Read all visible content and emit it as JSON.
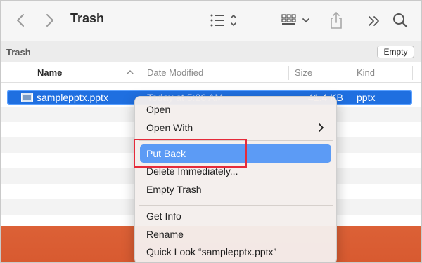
{
  "toolbar": {
    "title": "Trash"
  },
  "pathbar": {
    "label": "Trash",
    "empty_button": "Empty"
  },
  "columns": {
    "name": "Name",
    "date_modified": "Date Modified",
    "size": "Size",
    "kind": "Kind"
  },
  "file": {
    "name": "samplepptx.pptx",
    "date": "Today at 5:26 AM",
    "size": "41.4 KB",
    "kind": "pptx"
  },
  "context_menu": {
    "items": [
      {
        "label": "Open"
      },
      {
        "label": "Open With"
      },
      {
        "label": "Put Back"
      },
      {
        "label": "Delete Immediately..."
      },
      {
        "label": "Empty Trash"
      },
      {
        "label": "Get Info"
      },
      {
        "label": "Rename"
      },
      {
        "label": "Quick Look “samplepptx.pptx”"
      }
    ]
  },
  "colors": {
    "selection": "#1f6fe0",
    "menu_highlight": "#5c9bf5",
    "annotation_box": "#e52b3a"
  },
  "icons": [
    "back-chevron-icon",
    "forward-chevron-icon",
    "list-view-icon",
    "icon-view-icon",
    "share-icon",
    "more-chevron-icon",
    "search-icon",
    "pptx-file-icon",
    "submenu-chevron-icon"
  ]
}
